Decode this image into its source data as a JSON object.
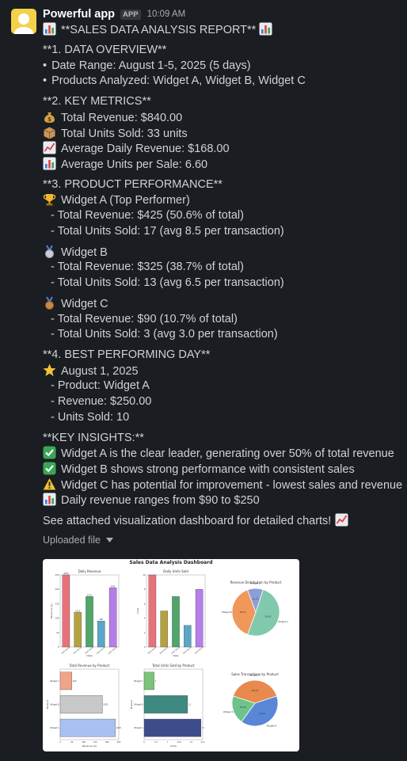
{
  "app": {
    "name": "Powerful app",
    "badge": "APP",
    "time": "10:09 AM"
  },
  "report": {
    "title": "**SALES DATA ANALYSIS REPORT**",
    "s1": {
      "heading": "**1. DATA OVERVIEW**",
      "items": [
        "Date Range: August 1-5, 2025 (5 days)",
        "Products Analyzed: Widget A, Widget B, Widget C"
      ]
    },
    "s2": {
      "heading": "**2. KEY METRICS**",
      "items": [
        "Total Revenue: $840.00",
        "Total Units Sold: 33 units",
        "Average Daily Revenue: $168.00",
        "Average Units per Sale: 6.60"
      ]
    },
    "s3": {
      "heading": "**3. PRODUCT PERFORMANCE**",
      "products": [
        {
          "name": "Widget A (Top Performer)",
          "revenue": "- Total Revenue: $425 (50.6% of total)",
          "units": "- Total Units Sold: 17 (avg 8.5 per transaction)"
        },
        {
          "name": "Widget B",
          "revenue": "- Total Revenue: $325 (38.7% of total)",
          "units": "- Total Units Sold: 13 (avg 6.5 per transaction)"
        },
        {
          "name": "Widget C",
          "revenue": "- Total Revenue: $90 (10.7% of total)",
          "units": "- Total Units Sold: 3 (avg 3.0 per transaction)"
        }
      ]
    },
    "s4": {
      "heading": "**4. BEST PERFORMING DAY**",
      "date": "August 1, 2025",
      "items": [
        "- Product: Widget A",
        "- Revenue: $250.00",
        "- Units Sold: 10"
      ]
    },
    "s5": {
      "heading": "**KEY INSIGHTS:**",
      "items": [
        "Widget A is the clear leader, generating over 50% of total revenue",
        "Widget B shows strong performance with consistent sales",
        "Widget C has potential for improvement - lowest sales and revenue",
        "Daily revenue ranges from $90 to $250"
      ]
    },
    "closing": "See attached visualization dashboard for detailed charts!"
  },
  "file": {
    "label": "Uploaded file"
  },
  "icons": [
    "chart-icon",
    "money-bag-icon",
    "package-icon",
    "trend-up-icon",
    "trophy-icon",
    "silver-medal-icon",
    "bronze-medal-icon",
    "star-icon",
    "check-icon",
    "warning-icon"
  ],
  "colors": {
    "background": "#1a1d21",
    "text": "#d1d2d3",
    "avatar": "#f3d24a"
  },
  "dashboard": {
    "title": "Sales Data Analysis Dashboard",
    "daily_revenue_title": "Daily Revenue",
    "daily_units_title": "Daily Units Sold",
    "pie_dist_title": "Revenue Distribution by Product",
    "total_rev_title": "Total Revenue by Product",
    "total_units_title": "Total Units Sold by Product",
    "transactions_title": "Sales Transactions by Product"
  },
  "chart_data": [
    {
      "type": "bar",
      "title": "Daily Revenue",
      "xlabel": "Date",
      "ylabel": "Revenue ($)",
      "categories": [
        "2025-08-01",
        "2025-08-02",
        "2025-08-03",
        "2025-08-04",
        "2025-08-05"
      ],
      "values": [
        250,
        120,
        175,
        90,
        205
      ],
      "value_labels": [
        "$250",
        "$120",
        "$175",
        "$90",
        "$205"
      ],
      "ylim": [
        0,
        250
      ],
      "colors": [
        "#e8727a",
        "#b5a23e",
        "#4fa56a",
        "#5aa6c8",
        "#b57ee8"
      ]
    },
    {
      "type": "bar",
      "title": "Daily Units Sold",
      "xlabel": "Date",
      "ylabel": "Units",
      "categories": [
        "2025-08-01",
        "2025-08-02",
        "2025-08-03",
        "2025-08-04",
        "2025-08-05"
      ],
      "values": [
        10,
        5,
        7,
        3,
        8
      ],
      "ylim": [
        0,
        10
      ],
      "colors": [
        "#e8727a",
        "#b5a23e",
        "#4fa56a",
        "#5aa6c8",
        "#b57ee8"
      ]
    },
    {
      "type": "pie",
      "title": "Revenue Distribution by Product",
      "labels": [
        "Widget A",
        "Widget B",
        "Widget C"
      ],
      "values": [
        50.6,
        38.7,
        10.7
      ],
      "pct_labels": [
        "50.6%",
        "38.7%",
        "10.7%"
      ],
      "colors": [
        "#80c9ad",
        "#f0975a",
        "#8b9fd6"
      ]
    },
    {
      "type": "bar",
      "orientation": "horizontal",
      "title": "Total Revenue by Product",
      "xlabel": "Revenue ($)",
      "ylabel": "Product",
      "categories": [
        "Widget C",
        "Widget B",
        "Widget A"
      ],
      "values": [
        90,
        325,
        425
      ],
      "value_labels": [
        "$90",
        "$325",
        "$425"
      ],
      "xlim": [
        0,
        450
      ],
      "colors": [
        "#f0a58a",
        "#c8c8c8",
        "#a9c1f2"
      ]
    },
    {
      "type": "bar",
      "orientation": "horizontal",
      "title": "Total Units Sold by Product",
      "xlabel": "Units",
      "ylabel": "Product",
      "categories": [
        "Widget C",
        "Widget B",
        "Widget A"
      ],
      "values": [
        3,
        13,
        17
      ],
      "xlim": [
        0,
        17.5
      ],
      "colors": [
        "#7bc47a",
        "#3f8a80",
        "#3f4c8c"
      ]
    },
    {
      "type": "pie",
      "title": "Sales Transactions by Product",
      "labels": [
        "Widget A",
        "Widget B",
        "Widget C"
      ],
      "values": [
        40,
        40,
        20
      ],
      "pct_labels": [
        "40.0%",
        "40.0%",
        "20.0%"
      ],
      "colors": [
        "#e8894d",
        "#5a86d8",
        "#6cc48a"
      ]
    }
  ]
}
